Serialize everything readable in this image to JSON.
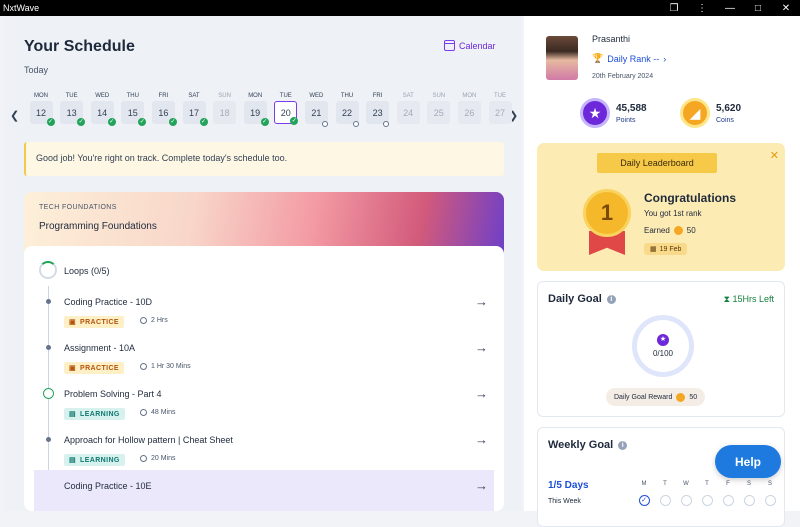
{
  "app": {
    "title": "NxtWave"
  },
  "window_controls": [
    "❐",
    "⋮",
    "—",
    "□",
    "✕"
  ],
  "schedule": {
    "title": "Your Schedule",
    "subtitle": "Today",
    "calendar_link": "Calendar",
    "days": [
      {
        "dow": "MON",
        "date": "12",
        "state": "done"
      },
      {
        "dow": "TUE",
        "date": "13",
        "state": "done"
      },
      {
        "dow": "WED",
        "date": "14",
        "state": "done"
      },
      {
        "dow": "THU",
        "date": "15",
        "state": "done"
      },
      {
        "dow": "FRI",
        "date": "16",
        "state": "done"
      },
      {
        "dow": "SAT",
        "date": "17",
        "state": "done"
      },
      {
        "dow": "SUN",
        "date": "18",
        "state": "off"
      },
      {
        "dow": "MON",
        "date": "19",
        "state": "done"
      },
      {
        "dow": "TUE",
        "date": "20",
        "state": "selected"
      },
      {
        "dow": "WED",
        "date": "21",
        "state": "locked"
      },
      {
        "dow": "THU",
        "date": "22",
        "state": "locked"
      },
      {
        "dow": "FRI",
        "date": "23",
        "state": "locked"
      },
      {
        "dow": "SAT",
        "date": "24",
        "state": "off"
      },
      {
        "dow": "SUN",
        "date": "25",
        "state": "off"
      },
      {
        "dow": "MON",
        "date": "26",
        "state": "off"
      },
      {
        "dow": "TUE",
        "date": "27",
        "state": "off"
      }
    ],
    "alert": "Good job! You're right on track. Complete today's schedule too."
  },
  "course": {
    "category": "TECH FOUNDATIONS",
    "name": "Programming Foundations",
    "topic": "Loops (0/5)",
    "items": [
      {
        "name": "Coding Practice - 10D",
        "tag": "PRACTICE",
        "duration": "2 Hrs"
      },
      {
        "name": "Assignment - 10A",
        "tag": "PRACTICE",
        "duration": "1 Hr 30 Mins"
      },
      {
        "name": "Problem Solving - Part 4",
        "tag": "LEARNING",
        "duration": "48 Mins"
      },
      {
        "name": "Approach for Hollow pattern | Cheat Sheet",
        "tag": "LEARNING",
        "duration": "20 Mins"
      },
      {
        "name": "Coding Practice - 10E",
        "tag": "PRACTICE",
        "duration": ""
      }
    ]
  },
  "profile": {
    "name": "Prasanthi",
    "rank": "Daily Rank --",
    "date": "20th February 2024",
    "points_value": "45,588",
    "points_label": "Points",
    "coins_value": "5,620",
    "coins_label": "Coins"
  },
  "leaderboard": {
    "title": "Daily Leaderboard",
    "medal": "1",
    "congrats": "Congratulations",
    "rank_text": "You got 1st rank",
    "earned_label": "Earned",
    "earned_value": "50",
    "date": "19 Feb"
  },
  "daily_goal": {
    "title": "Daily Goal",
    "time_left": "15Hrs Left",
    "progress": "0/100",
    "reward_label": "Daily Goal Reward",
    "reward_value": "50"
  },
  "weekly_goal": {
    "title": "Weekly Goal",
    "days_text": "1/5 Days",
    "this_week": "This Week",
    "weekdays": [
      "M",
      "T",
      "W",
      "T",
      "F",
      "S",
      "S"
    ]
  },
  "help": {
    "label": "Help"
  },
  "colors": {
    "accent": "#6d28d9",
    "success": "#22a35a",
    "help": "#1f7ae0"
  }
}
